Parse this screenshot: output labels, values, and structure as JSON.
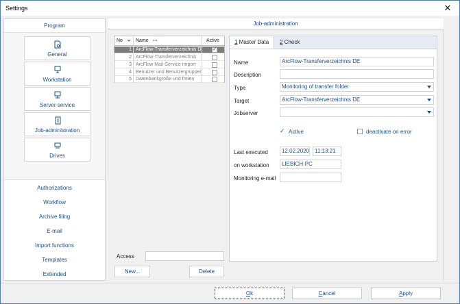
{
  "window": {
    "title": "Settings"
  },
  "program": {
    "header": "Program",
    "modules": [
      {
        "label": "General",
        "icon": "settings-page-icon"
      },
      {
        "label": "Workstation",
        "icon": "workstation-icon"
      },
      {
        "label": "Server service",
        "icon": "server-icon"
      },
      {
        "label": "Job-administration",
        "icon": "document-icon"
      },
      {
        "label": "Drives",
        "icon": "drive-icon"
      }
    ],
    "links": [
      "Authorizations",
      "Workflow",
      "Archive filing",
      "E-mail",
      "Import functions",
      "Templates",
      "Extended"
    ]
  },
  "main": {
    "header": "Job-administration",
    "table": {
      "col_no": "No",
      "col_name": "Name",
      "col_active": "Active",
      "rows": [
        {
          "no": "1",
          "name": "ArcFlow-Transferverzeichnis DE",
          "active": true
        },
        {
          "no": "2",
          "name": "ArcFlow-Transferverzeichnis",
          "active": false
        },
        {
          "no": "3",
          "name": "ArcFlow Mail-Service Import",
          "active": false
        },
        {
          "no": "4",
          "name": "Benutzer und Benutzergruppen",
          "active": false
        },
        {
          "no": "5",
          "name": "Datenbankgröße und freien",
          "active": false
        }
      ]
    },
    "access_label": "Access",
    "access_value": "",
    "new_button": "New...",
    "delete_button": "Delete"
  },
  "tabs": [
    {
      "key": "1",
      "rest": " Master Data",
      "active": true
    },
    {
      "key": "2",
      "rest": " Check",
      "active": false
    }
  ],
  "form": {
    "name_label": "Name",
    "name_value": "ArcFlow-Transferverzeichnis DE",
    "description_label": "Description",
    "description_value": "",
    "type_label": "Type",
    "type_value": "Monitoring of transfer folder",
    "target_label": "Target",
    "target_value": "ArcFlow-Transferverzeichnis DE",
    "jobserver_label": "Jobserver",
    "jobserver_value": "",
    "active_label": "Active",
    "deactivate_label": "deactivate on error",
    "last_executed_label": "Last executed",
    "last_executed_date": "12.02.2020",
    "last_executed_time": "11:13:21",
    "workstation_label": "on workstation",
    "workstation_value": "LIEBICH-PC",
    "monitoring_email_label": "Monitoring e-mail",
    "monitoring_email_value": ""
  },
  "footer": {
    "ok_key": "O",
    "ok_rest": "k",
    "cancel_key": "C",
    "cancel_rest": "ancel",
    "apply_key": "A",
    "apply_rest": "pply"
  }
}
